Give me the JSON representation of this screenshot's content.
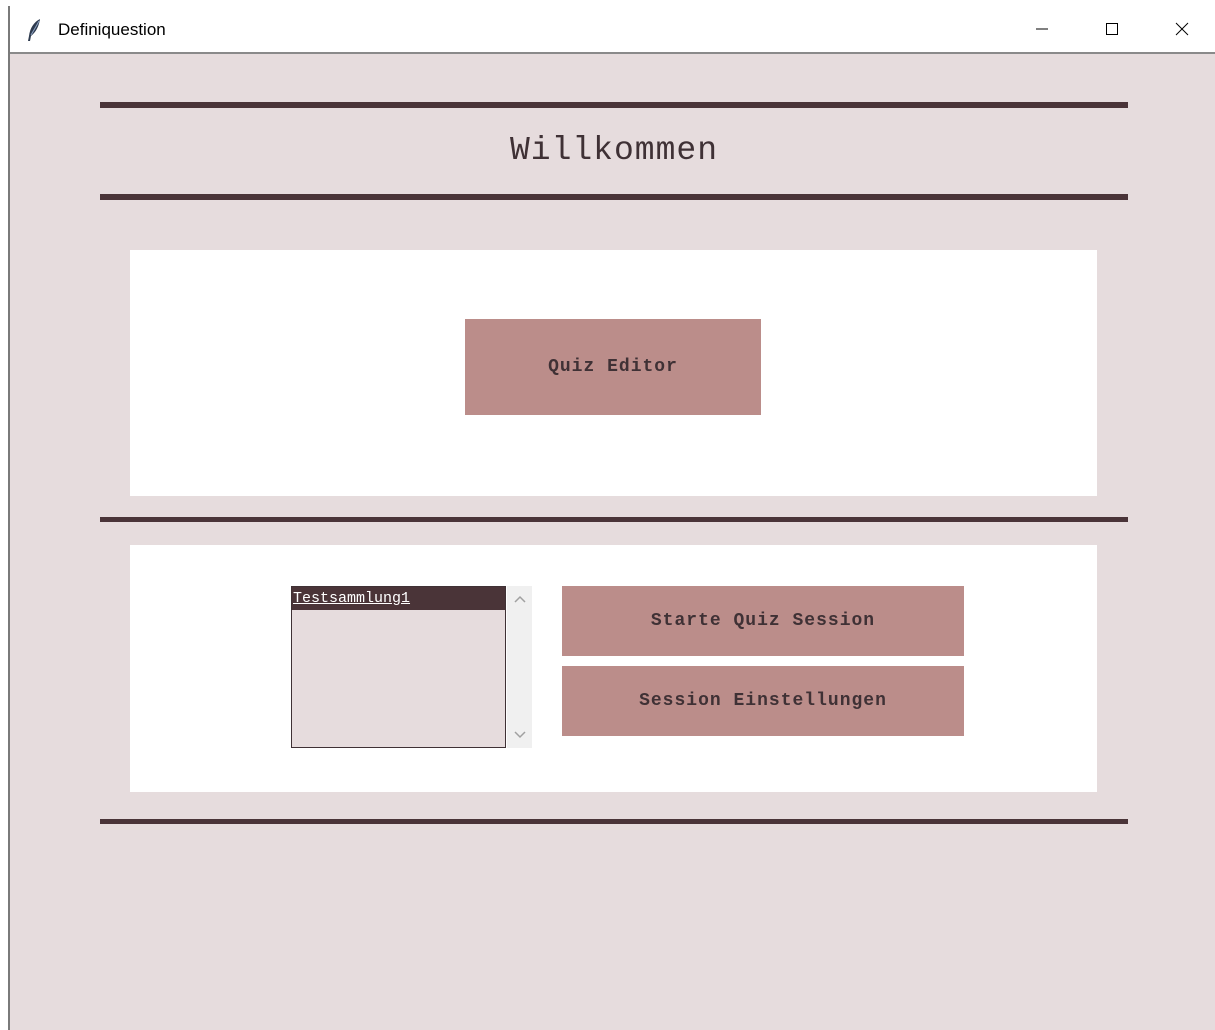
{
  "window": {
    "title": "Definiquestion",
    "icon": "feather-icon"
  },
  "header": {
    "welcome_text": "Willkommen"
  },
  "editor_panel": {
    "quiz_editor_label": "Quiz Editor"
  },
  "session_panel": {
    "list_items": [
      {
        "label": "Testsammlung1",
        "selected": true
      }
    ],
    "start_session_label": "Starte Quiz Session",
    "session_settings_label": "Session Einstellungen"
  },
  "colors": {
    "background": "#e6dcdd",
    "rule": "#4a3438",
    "button": "#bb8d8a",
    "text": "#3f3135",
    "selection": "#4a3438"
  }
}
